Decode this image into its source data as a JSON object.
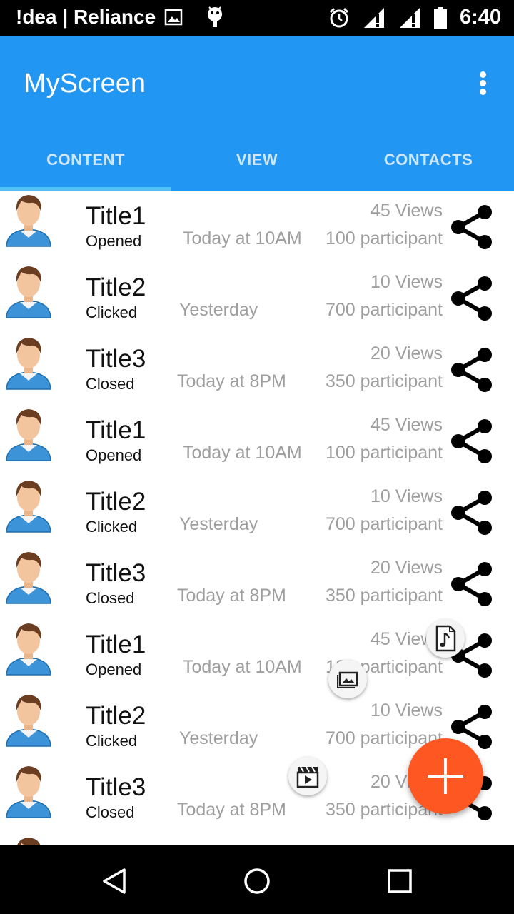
{
  "status_bar": {
    "carrier": "!dea | Reliance",
    "time": "6:40",
    "icons": [
      "image-icon",
      "android-icon",
      "alarm-icon",
      "signal-icon",
      "signal-icon",
      "battery-icon"
    ]
  },
  "app_bar": {
    "title": "MyScreen",
    "menu_icon": "overflow-menu-icon",
    "background_color": "#2196f3"
  },
  "tabs": [
    {
      "label": "CONTENT",
      "selected": true
    },
    {
      "label": "VIEW",
      "selected": false
    },
    {
      "label": "CONTACTS",
      "selected": false
    }
  ],
  "list": {
    "items": [
      {
        "title": "Title1",
        "status": "Opened",
        "time": "Today at 10AM",
        "views": "45 Views",
        "participants": "100 participant"
      },
      {
        "title": "Title2",
        "status": "Clicked",
        "time": "Yesterday",
        "views": "10 Views",
        "participants": "700 participant"
      },
      {
        "title": "Title3",
        "status": "Closed",
        "time": "Today at 8PM",
        "views": "20 Views",
        "participants": "350 participant"
      },
      {
        "title": "Title1",
        "status": "Opened",
        "time": "Today at 10AM",
        "views": "45 Views",
        "participants": "100 participant"
      },
      {
        "title": "Title2",
        "status": "Clicked",
        "time": "Yesterday",
        "views": "10 Views",
        "participants": "700 participant"
      },
      {
        "title": "Title3",
        "status": "Closed",
        "time": "Today at 8PM",
        "views": "20 Views",
        "participants": "350 participant"
      },
      {
        "title": "Title1",
        "status": "Opened",
        "time": "Today at 10AM",
        "views": "45 Views",
        "participants": "100 participant"
      },
      {
        "title": "Title2",
        "status": "Clicked",
        "time": "Yesterday",
        "views": "10 Views",
        "participants": "700 participant"
      },
      {
        "title": "Title3",
        "status": "Closed",
        "time": "Today at 8PM",
        "views": "20 Views",
        "participants": "350 participant"
      }
    ]
  },
  "fab": {
    "icon": "plus-icon",
    "color": "#ff5722",
    "menu_icons": [
      "music-file-icon",
      "image-icon",
      "video-clapper-icon"
    ]
  },
  "nav_bar": {
    "icons": [
      "back-icon",
      "home-icon",
      "recents-icon"
    ]
  }
}
